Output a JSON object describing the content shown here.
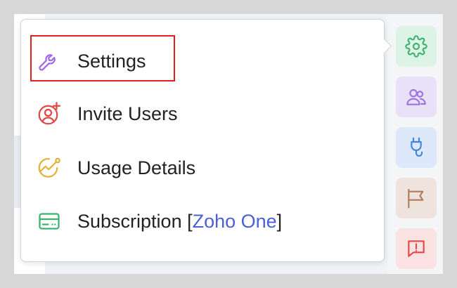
{
  "menu": {
    "items": [
      {
        "id": "settings",
        "label": "Settings",
        "icon": "wrench-icon",
        "color": "#a06ae6"
      },
      {
        "id": "invite-users",
        "label": "Invite Users",
        "icon": "add-user-icon",
        "color": "#e04848"
      },
      {
        "id": "usage-details",
        "label": "Usage Details",
        "icon": "usage-chart-icon",
        "color": "#e2b23c"
      },
      {
        "id": "subscription",
        "label": "Subscription [",
        "plan": "Zoho One",
        "label_suffix": "]",
        "icon": "credit-card-icon",
        "color": "#3bb36e"
      }
    ],
    "selected": "settings"
  },
  "rail": {
    "buttons": [
      {
        "name": "gear-icon",
        "bg": "#dcf3e6",
        "color": "#3bb36e"
      },
      {
        "name": "users-icon",
        "bg": "#e8e1f7",
        "color": "#9a74e0"
      },
      {
        "name": "plug-icon",
        "bg": "#dde9fb",
        "color": "#3d86e0"
      },
      {
        "name": "flag-icon",
        "bg": "#efe3dd",
        "color": "#b07a5c"
      },
      {
        "name": "feedback-icon",
        "bg": "#fbe2e2",
        "color": "#e04848"
      }
    ]
  },
  "colors": {
    "accent_plan": "#4a5fd8",
    "highlight_border": "#e02020"
  }
}
